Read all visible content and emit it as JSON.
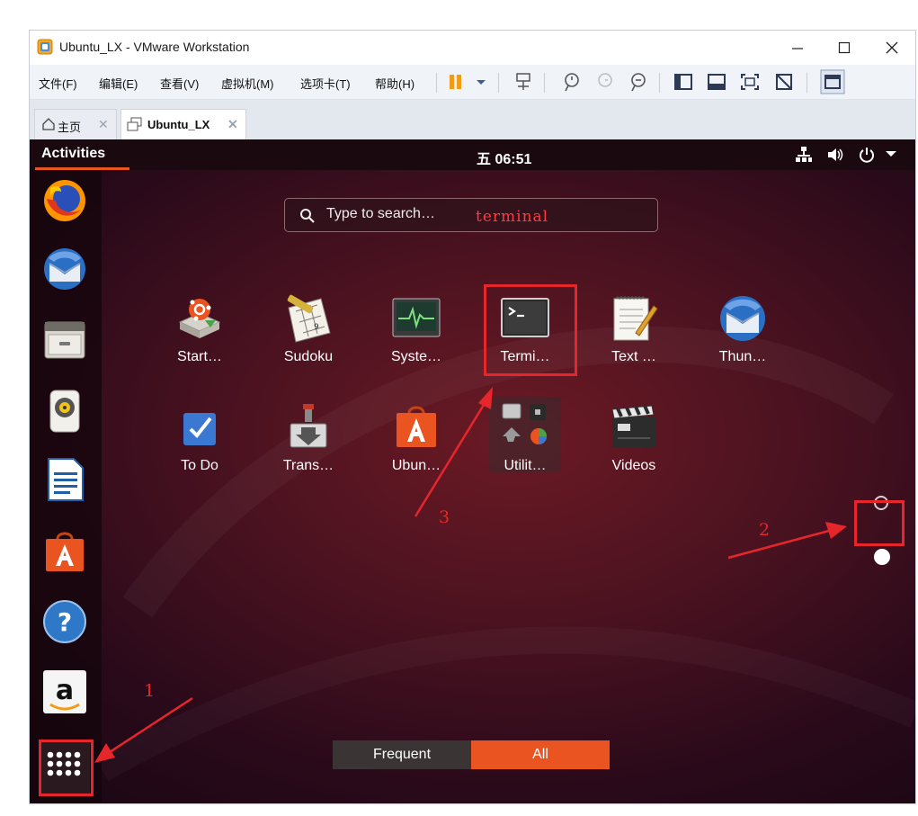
{
  "window": {
    "title": "Ubuntu_LX - VMware Workstation"
  },
  "menu": {
    "items": [
      "文件(F)",
      "编辑(E)",
      "查看(V)",
      "虚拟机(M)",
      "选项卡(T)",
      "帮助(H)"
    ]
  },
  "tabs": [
    {
      "label": "主页",
      "close": "✕"
    },
    {
      "label": "Ubuntu_LX",
      "close": "✕"
    }
  ],
  "guest": {
    "activities": "Activities",
    "clock": "五 06:51",
    "search": {
      "placeholder": "Type to search…",
      "typed": "terminal"
    },
    "apps": [
      {
        "label": "Start…",
        "icon": "startup-disk-icon"
      },
      {
        "label": "Sudoku",
        "icon": "sudoku-icon"
      },
      {
        "label": "Syste…",
        "icon": "system-monitor-icon"
      },
      {
        "label": "Termi…",
        "icon": "terminal-icon"
      },
      {
        "label": "Text …",
        "icon": "text-editor-icon"
      },
      {
        "label": "Thun…",
        "icon": "thunderbird-icon"
      },
      {
        "label": "To Do",
        "icon": "todo-icon"
      },
      {
        "label": "Trans…",
        "icon": "transmission-icon"
      },
      {
        "label": "Ubun…",
        "icon": "ubuntu-software-icon"
      },
      {
        "label": "Utilit…",
        "icon": "utilities-folder-icon"
      },
      {
        "label": "Videos",
        "icon": "videos-icon"
      }
    ],
    "dock": [
      "firefox-icon",
      "thunderbird-icon",
      "files-icon",
      "rhythmbox-icon",
      "libreoffice-writer-icon",
      "ubuntu-software-icon",
      "help-icon",
      "amazon-icon",
      "show-applications-icon"
    ],
    "switch": {
      "frequent": "Frequent",
      "all": "All"
    }
  },
  "annotations": [
    "1",
    "2",
    "3"
  ],
  "colors": {
    "ubuntu_orange": "#e95420",
    "annotation_red": "#e7262b"
  }
}
